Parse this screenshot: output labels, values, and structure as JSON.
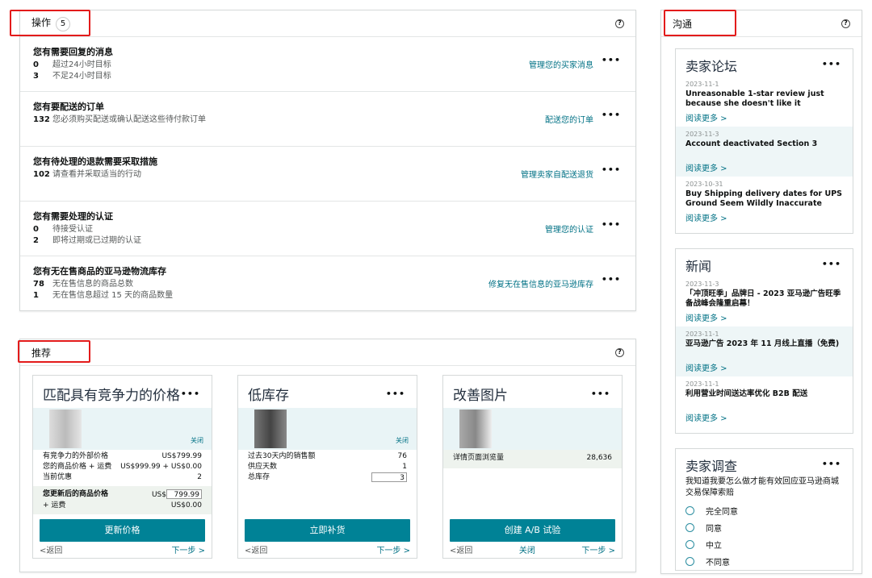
{
  "actions": {
    "title": "操作",
    "count": "5",
    "rows": [
      {
        "title": "您有需要回复的消息",
        "lines": [
          {
            "n": "0",
            "t": "超过24小时目标"
          },
          {
            "n": "3",
            "t": "不足24小时目标"
          }
        ],
        "link": "管理您的买家消息"
      },
      {
        "title": "您有要配送的订单",
        "lines": [
          {
            "n": "132",
            "t": "您必须购买配送或确认配送这些待付款订单"
          }
        ],
        "link": "配送您的订单"
      },
      {
        "title": "您有待处理的退款需要采取措施",
        "lines": [
          {
            "n": "102",
            "t": "请查看并采取适当的行动"
          }
        ],
        "link": "管理卖家自配送退货"
      },
      {
        "title": "您有需要处理的认证",
        "lines": [
          {
            "n": "0",
            "t": "待接受认证"
          },
          {
            "n": "2",
            "t": "即将过期或已过期的认证"
          }
        ],
        "link": "管理您的认证"
      },
      {
        "title": "您有无在售商品的亚马逊物流库存",
        "lines": [
          {
            "n": "78",
            "t": "无在售信息的商品总数"
          },
          {
            "n": "1",
            "t": "无在售信息超过 15 天的商品数量"
          }
        ],
        "link": "修复无在售信息的亚马逊库存"
      }
    ]
  },
  "recommend": {
    "title": "推荐",
    "cards": [
      {
        "title": "匹配具有竞争力的价格",
        "close": "关闭",
        "rows": [
          {
            "k": "有竞争力的外部价格",
            "v": "US$799.99"
          },
          {
            "k": "您的商品价格 + 运费",
            "v": "US$999.99 + US$0.00"
          },
          {
            "k": "当前优惠",
            "v": "2"
          }
        ],
        "new_label": "您更新后的商品价格",
        "currency": "US$",
        "new_price": "799.99",
        "ship_label": "+ 运费",
        "ship_value": "US$0.00",
        "button": "更新价格",
        "back": "<返回",
        "next": "下一步 >"
      },
      {
        "title": "低库存",
        "close": "关闭",
        "rows": [
          {
            "k": "过去30天内的销售额",
            "v": "76"
          },
          {
            "k": "供应天数",
            "v": "1"
          }
        ],
        "stock_label": "总库存",
        "stock_value": "3",
        "button": "立即补货",
        "back": "<返回",
        "next": "下一步 >"
      },
      {
        "title": "改善图片",
        "rows": [
          {
            "k": "详情页面浏览量",
            "v": "28,636"
          }
        ],
        "button": "创建 A/B 试验",
        "back": "<返回",
        "close": "关闭",
        "next": "下一步 >"
      }
    ]
  },
  "comm": {
    "title": "沟通",
    "forum": {
      "title": "卖家论坛",
      "posts": [
        {
          "date": "2023-11-1",
          "title": "Unreasonable 1-star review just because she doesn't like it",
          "more": "阅读更多 >"
        },
        {
          "date": "2023-11-3",
          "title": "Account deactivated Section 3",
          "more": "阅读更多 >"
        },
        {
          "date": "2023-10-31",
          "title": "Buy Shipping delivery dates for UPS Ground Seem Wildly Inaccurate",
          "more": "阅读更多 >"
        }
      ]
    },
    "news": {
      "title": "新闻",
      "posts": [
        {
          "date": "2023-11-3",
          "title": "「冲顶旺季」品牌日 - 2023 亚马逊广告旺季备战峰会隆重启幕！",
          "more": "阅读更多 >"
        },
        {
          "date": "2023-11-1",
          "title": "亚马逊广告 2023 年 11 月线上直播（免费)",
          "more": "阅读更多 >"
        },
        {
          "date": "2023-11-1",
          "title": "利用营业时间送达率优化 B2B 配送",
          "more": "阅读更多 >"
        }
      ]
    },
    "survey": {
      "title": "卖家调查",
      "question": "我知道我要怎么做才能有效回应亚马逊商城交易保障索赔",
      "options": [
        "完全同意",
        "同意",
        "中立",
        "不同意"
      ]
    }
  },
  "colors": {
    "accent": "#008296",
    "link": "#007185",
    "highlight": "#e31b1b"
  }
}
